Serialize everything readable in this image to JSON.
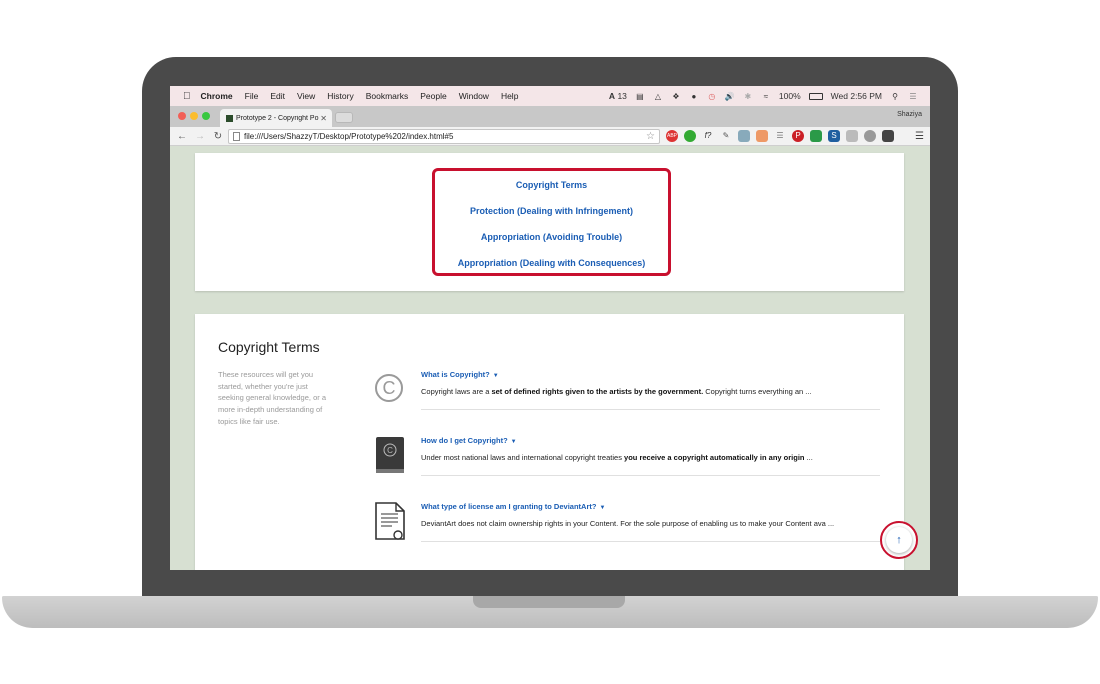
{
  "menubar": {
    "app_name": "Chrome",
    "items": [
      "File",
      "Edit",
      "View",
      "History",
      "Bookmarks",
      "People",
      "Window",
      "Help"
    ],
    "status": {
      "adobe_count": "13",
      "battery": "100%",
      "datetime": "Wed 2:56 PM"
    }
  },
  "browser": {
    "tab_title": "Prototype 2 - Copyright Po",
    "profile_name": "Shaziya",
    "url": "file:///Users/ShazzyT/Desktop/Prototype%202/index.html#5"
  },
  "toc": {
    "links": [
      "Copyright Terms",
      "Protection (Dealing with Infringement)",
      "Appropriation (Avoiding Trouble)",
      "Appropriation (Dealing with Consequences)"
    ]
  },
  "section": {
    "title": "Copyright Terms",
    "description": "These resources will get you started, whether you're just seeking general knowledge, or a more in-depth understanding of topics like fair use."
  },
  "faq": [
    {
      "question": "What is Copyright?",
      "answer_pre": "Copyright laws are a ",
      "answer_bold": "set of defined rights given to the artists by the government.",
      "answer_post": " Copyright turns everything an ...",
      "icon": "copyright-circle-icon"
    },
    {
      "question": "How do I get Copyright?",
      "answer_pre": "Under most national laws and international copyright treaties ",
      "answer_bold": "you receive a copyright automatically in any origin",
      "answer_post": " ...",
      "icon": "copyright-book-icon"
    },
    {
      "question": "What type of license am I granting to DeviantArt?",
      "answer_pre": "DeviantArt does not claim ownership rights in your Content. For the sole purpose of enabling us to make your Content ava ...",
      "answer_bold": "",
      "answer_post": "",
      "icon": "license-document-icon"
    }
  ],
  "colors": {
    "link_blue": "#1a5db4",
    "highlight_red": "#c8102e",
    "page_bg": "#d7e0d2"
  }
}
